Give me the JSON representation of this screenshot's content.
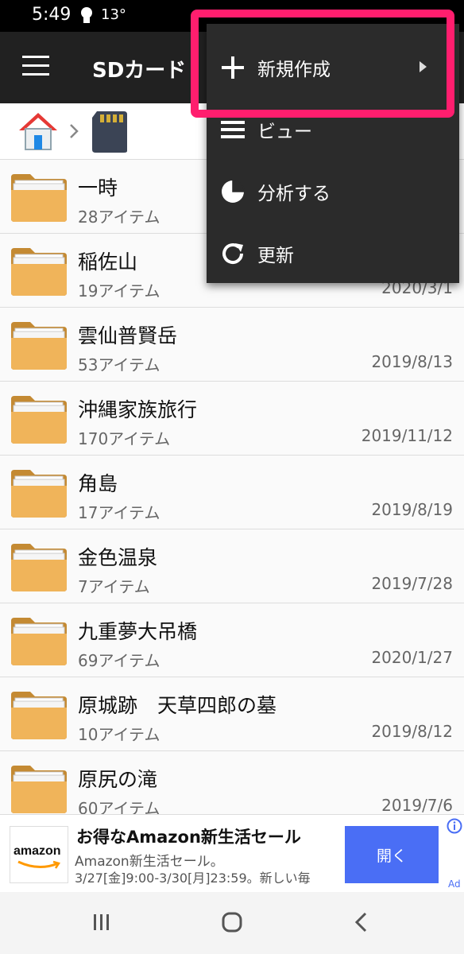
{
  "status_bar": {
    "time": "5:49",
    "temperature": "13°"
  },
  "app_bar": {
    "title": "SDカード"
  },
  "breadcrumb": {
    "separator": "›"
  },
  "files": [
    {
      "name": "一時",
      "count": "28アイテム",
      "date": ""
    },
    {
      "name": "稲佐山",
      "count": "19アイテム",
      "date": "2020/3/1"
    },
    {
      "name": "雲仙普賢岳",
      "count": "53アイテム",
      "date": "2019/8/13"
    },
    {
      "name": "沖縄家族旅行",
      "count": "170アイテム",
      "date": "2019/11/12"
    },
    {
      "name": "角島",
      "count": "17アイテム",
      "date": "2019/8/19"
    },
    {
      "name": "金色温泉",
      "count": "7アイテム",
      "date": "2019/7/28"
    },
    {
      "name": "九重夢大吊橋",
      "count": "69アイテム",
      "date": "2020/1/27"
    },
    {
      "name": "原城跡　天草四郎の墓",
      "count": "10アイテム",
      "date": "2019/8/12"
    },
    {
      "name": "原尻の滝",
      "count": "60アイテム",
      "date": "2019/7/6"
    }
  ],
  "ad": {
    "logo_text": "amazon",
    "title": "お得なAmazon新生活セール",
    "line1": "Amazon新生活セール。",
    "line2": "3/27[金]9:00-3/30[月]23:59。新しい毎",
    "button": "開く",
    "label": "Ad"
  },
  "overflow_menu": {
    "items": [
      {
        "label": "新規作成",
        "icon": "plus-icon",
        "has_submenu": true
      },
      {
        "label": "ビュー",
        "icon": "list-view-icon"
      },
      {
        "label": "分析する",
        "icon": "pie-chart-icon"
      },
      {
        "label": "更新",
        "icon": "refresh-icon"
      }
    ]
  },
  "colors": {
    "app_bar": "#212121",
    "menu_background": "#2b2b2b",
    "highlight": "#ff1e6e",
    "ad_button": "#4a6ef5",
    "folder": "#f0b45a"
  }
}
